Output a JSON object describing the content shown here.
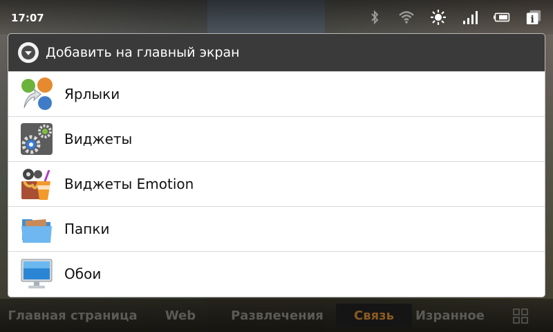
{
  "status_bar": {
    "time": "17:07",
    "icons": [
      "bluetooth-icon",
      "wifi-icon",
      "brightness-icon",
      "signal-icon",
      "battery-icon",
      "info-icon"
    ]
  },
  "dialog": {
    "title": "Добавить на главный экран",
    "title_icon": "chevron-down-icon",
    "items": [
      {
        "label": "Ярлыки",
        "icon": "shortcuts-icon"
      },
      {
        "label": "Виджеты",
        "icon": "widgets-icon"
      },
      {
        "label": "Виджеты Emotion",
        "icon": "emotion-widgets-icon"
      },
      {
        "label": "Папки",
        "icon": "folder-icon"
      },
      {
        "label": "Обои",
        "icon": "wallpaper-icon"
      }
    ]
  },
  "bottom_bar": {
    "tabs": [
      {
        "label": "Главная страница"
      },
      {
        "label": "Web"
      },
      {
        "label": "Развлечения"
      },
      {
        "label": "Связь",
        "active": true
      },
      {
        "label": "Изранное"
      }
    ],
    "grid_icon": "apps-grid-icon",
    "active_color": "#8a5a22",
    "inactive_color": "#5c5a55"
  }
}
